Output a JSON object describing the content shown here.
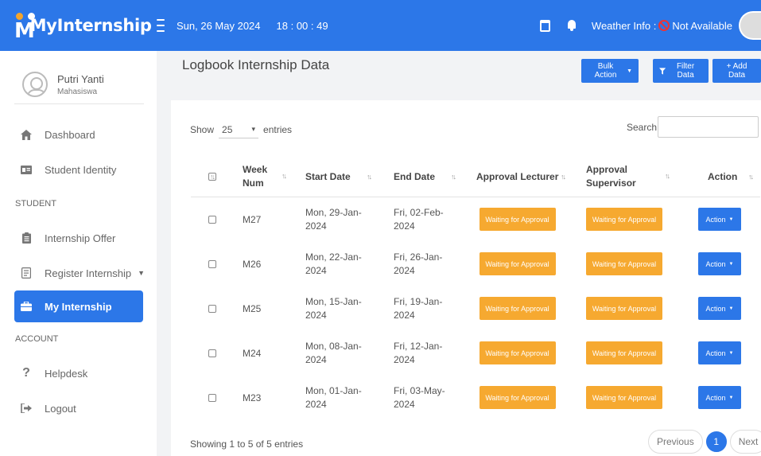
{
  "topbar": {
    "brand": "MyInternship",
    "date": "Sun, 26 May 2024",
    "time": "18 : 00 : 49",
    "weather_label": "Weather Info : ",
    "weather_value": "Not Available"
  },
  "sidebar": {
    "profile_name": "Putri Yanti",
    "profile_role": "Mahasiswa",
    "items": [
      {
        "label": "Dashboard"
      },
      {
        "label": "Student Identity"
      }
    ],
    "section_student": "STUDENT",
    "student_items": [
      {
        "label": "Internship Offer"
      },
      {
        "label": "Register Internship"
      },
      {
        "label": "My Internship"
      }
    ],
    "section_account": "ACCOUNT",
    "account_items": [
      {
        "label": "Helpdesk"
      },
      {
        "label": "Logout"
      }
    ]
  },
  "main": {
    "title": "Logbook Internship Data",
    "bulk_action": "Bulk Action",
    "filter_data": "Filter Data",
    "add_data": "+ Add Data",
    "show_label": "Show",
    "show_value": "25",
    "entries_label": "entries",
    "search_label": "Search:",
    "columns": [
      "Week Num",
      "Start Date",
      "End Date",
      "Approval Lecturer",
      "Approval Supervisor",
      "Action"
    ],
    "rows": [
      {
        "week": "M27",
        "start": "Mon, 29-Jan-2024",
        "end": "Fri, 02-Feb-2024",
        "lecturer": "Waiting for Approval",
        "supervisor": "Waiting for Approval",
        "action": "Action"
      },
      {
        "week": "M26",
        "start": "Mon, 22-Jan-2024",
        "end": "Fri, 26-Jan-2024",
        "lecturer": "Waiting for Approval",
        "supervisor": "Waiting for Approval",
        "action": "Action"
      },
      {
        "week": "M25",
        "start": "Mon, 15-Jan-2024",
        "end": "Fri, 19-Jan-2024",
        "lecturer": "Waiting for Approval",
        "supervisor": "Waiting for Approval",
        "action": "Action"
      },
      {
        "week": "M24",
        "start": "Mon, 08-Jan-2024",
        "end": "Fri, 12-Jan-2024",
        "lecturer": "Waiting for Approval",
        "supervisor": "Waiting for Approval",
        "action": "Action"
      },
      {
        "week": "M23",
        "start": "Mon, 01-Jan-2024",
        "end": "Fri, 03-May-2024",
        "lecturer": "Waiting for Approval",
        "supervisor": "Waiting for Approval",
        "action": "Action"
      }
    ],
    "info": "Showing 1 to 5 of 5 entries",
    "pager": {
      "previous": "Previous",
      "current": "1",
      "next": "Next"
    }
  },
  "colors": {
    "primary": "#2c77e8",
    "warning": "#f6a930",
    "accent_orange": "#f4a42a"
  }
}
